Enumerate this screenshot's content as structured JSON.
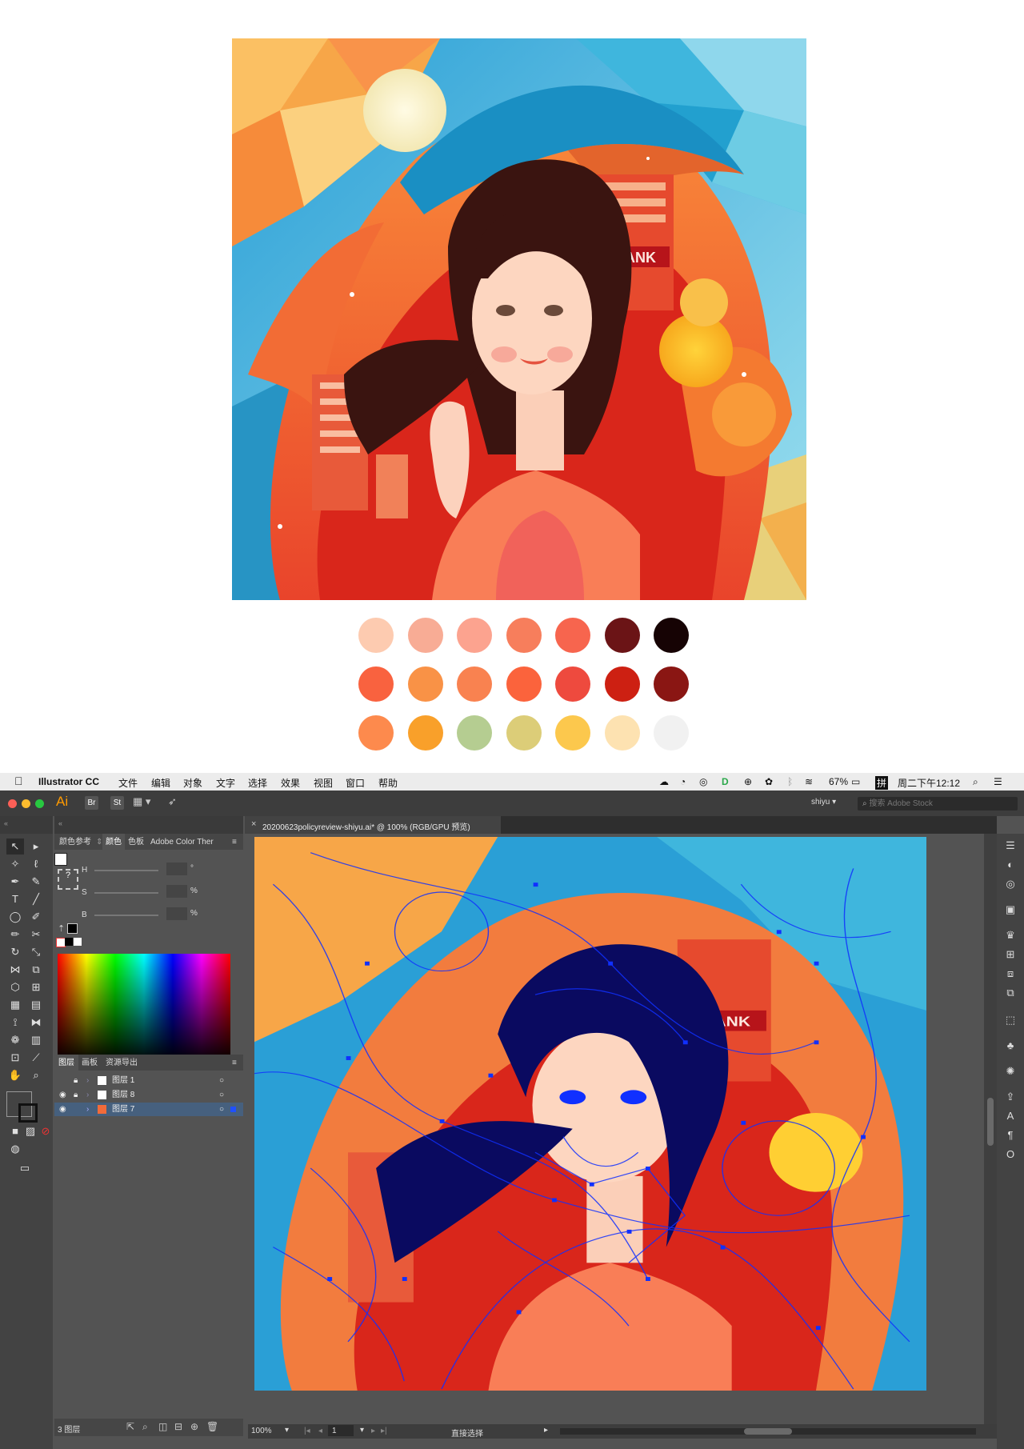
{
  "palette": {
    "rows": [
      [
        "#fdcbb0",
        "#f8ac95",
        "#fca38f",
        "#f77e5c",
        "#f7654e",
        "#6b1416",
        "#160304"
      ],
      [
        "#f9623f",
        "#f99246",
        "#f98250",
        "#fb633c",
        "#ee4a3e",
        "#cd2012",
        "#8a1613"
      ],
      [
        "#fd8a4d",
        "#f9a02a",
        "#b5cd91",
        "#dccd78",
        "#fcc84d",
        "#fde2b1",
        "#f1f1f1"
      ]
    ]
  },
  "menubar": {
    "app_name": "Illustrator CC",
    "items": [
      "文件",
      "编辑",
      "对象",
      "文字",
      "选择",
      "效果",
      "视图",
      "窗口",
      "帮助"
    ],
    "battery": "67%",
    "ime": "拼",
    "clock": "周二下午12:12"
  },
  "appbar": {
    "logo": "Ai",
    "bridge": "Br",
    "stock": "St",
    "workspace": "shiyu",
    "search_placeholder": "搜索 Adobe Stock"
  },
  "color_panel": {
    "tabs": [
      "颜色参考",
      "颜色",
      "色板",
      "Adobe Color Ther"
    ],
    "sliders": [
      {
        "label": "H",
        "unit": "°"
      },
      {
        "label": "S",
        "unit": "%"
      },
      {
        "label": "B",
        "unit": "%"
      }
    ]
  },
  "layers_panel": {
    "tabs": [
      "图层",
      "画板",
      "资源导出"
    ],
    "layers": [
      {
        "name": "图层 1",
        "visible": false,
        "locked": true,
        "selected": false
      },
      {
        "name": "图层 8",
        "visible": true,
        "locked": true,
        "selected": false
      },
      {
        "name": "图层 7",
        "visible": true,
        "locked": false,
        "selected": true
      }
    ],
    "count_label": "3 图层"
  },
  "document": {
    "tab_title": "20200623policyreview-shiyu.ai* @ 100% (RGB/GPU 预览)",
    "artboard_text": "BANK"
  },
  "statusbar": {
    "zoom": "100%",
    "artboard_number": "1",
    "tool_name": "直接选择"
  },
  "illustration": {
    "sign_text": "BANK"
  },
  "colors": {
    "app_bg": "#535353",
    "selection_blue": "#1030ff"
  }
}
